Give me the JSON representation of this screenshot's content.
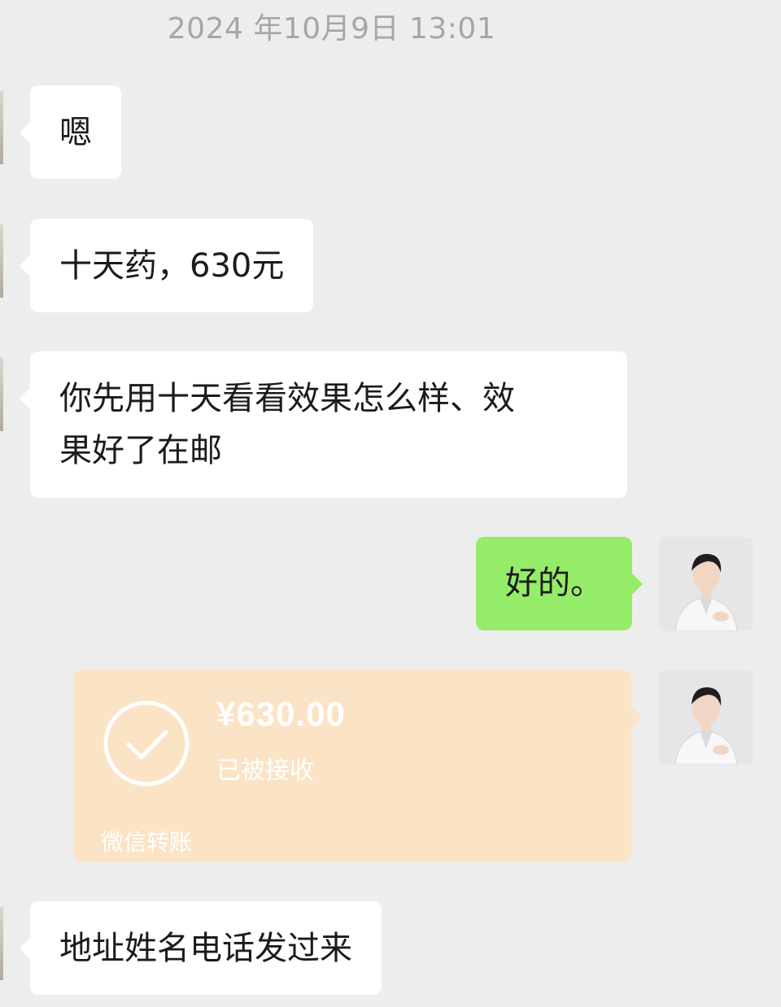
{
  "timestamp": "2024 年10月9日 13:01",
  "messages": {
    "m1": "嗯",
    "m2": "十天药，630元",
    "m3_line1": "你先用十天看看效果怎么样、效",
    "m3_line2": "果好了在邮",
    "m4": "好的。",
    "m6": "地址姓名电话发过来"
  },
  "transfer": {
    "amount": "¥630.00",
    "status": "已被接收",
    "footer": "微信转账"
  },
  "colors": {
    "background": "#ededed",
    "bubble_left": "#ffffff",
    "bubble_right": "#95ec69",
    "transfer_card": "#fbe3c5"
  },
  "icons": [
    "avatar",
    "check-circle-icon"
  ]
}
